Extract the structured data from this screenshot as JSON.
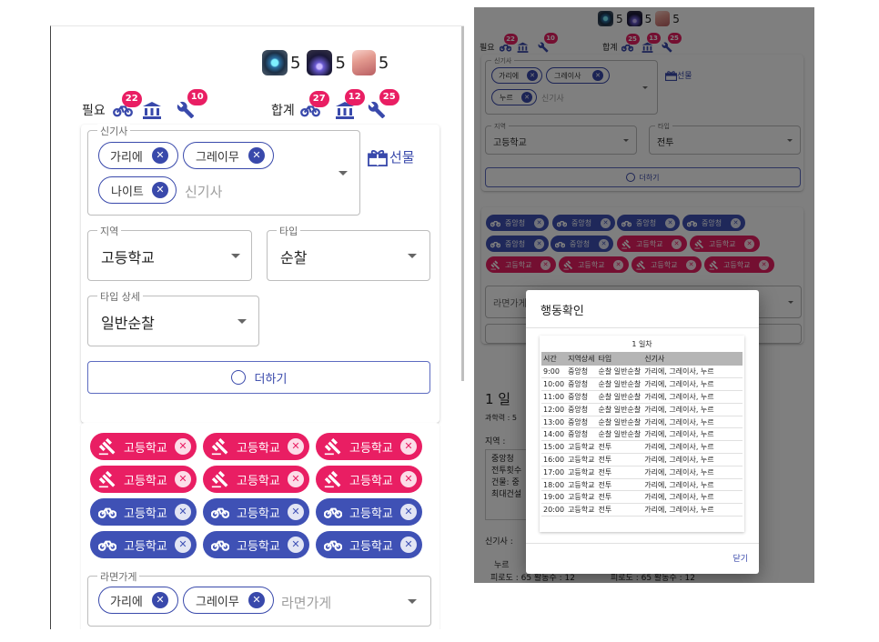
{
  "resources": [
    {
      "icon": "gear-crystal-icon",
      "value": "5"
    },
    {
      "icon": "dark-tower-icon",
      "value": "5"
    },
    {
      "icon": "scroll-book-icon",
      "value": "5"
    }
  ],
  "need": {
    "label": "필요",
    "badges": {
      "bike": "22",
      "bank": "",
      "wrench": "10"
    }
  },
  "total": {
    "label": "합계",
    "badges": {
      "bike": "27",
      "bank": "12",
      "wrench": "25"
    }
  },
  "form": {
    "shingisa_label": "신기사",
    "shingisa_chips": [
      "가리에",
      "그레이무",
      "나이트"
    ],
    "shingisa_placeholder": "신기사",
    "gift_label": "선물",
    "region_label": "지역",
    "region_value": "고등학교",
    "type_label": "타입",
    "type_value": "순찰",
    "type_detail_label": "타입 상세",
    "type_detail_value": "일반순찰",
    "add_label": "더하기"
  },
  "tags": {
    "red": [
      "고등학교",
      "고등학교",
      "고등학교",
      "고등학교",
      "고등학교",
      "고등학교"
    ],
    "blue": [
      "고등학교",
      "고등학교",
      "고등학교",
      "고등학교",
      "고등학교",
      "고등학교"
    ]
  },
  "shop": {
    "label": "라면가게",
    "chips": [
      "가리에",
      "그레이무"
    ],
    "placeholder": "라면가게"
  },
  "right": {
    "resources": [
      "5",
      "5",
      "5"
    ],
    "need_label": "필요",
    "need_badges": {
      "bike": "22",
      "wrench": "10"
    },
    "total_label": "합계",
    "total_badges": {
      "bike": "25",
      "bank": "13",
      "wrench": "25"
    },
    "shingisa_label": "신기사",
    "chips": [
      "가리에",
      "그레이사",
      "누르"
    ],
    "shingisa_placeholder": "신기사",
    "gift_label": "선물",
    "region_label": "지역",
    "region_value": "고등학교",
    "type_label": "타입",
    "type_value": "전투",
    "add_label": "더하기",
    "blue_tags": [
      "중앙청",
      "중앙청",
      "중앙청",
      "중앙청",
      "중앙청",
      "중앙청"
    ],
    "red_tags": [
      "고등학교",
      "고등학교",
      "고등학교",
      "고등학교",
      "고등학교",
      "고등학교",
      "고등학교",
      "고등학교"
    ],
    "shop_label": "라면가게",
    "day_title": "1 일",
    "science_label": "과학력 : 5",
    "region_text": "지역 :",
    "detail_lines": [
      "중앙청",
      "전투횟수",
      "건물: 중",
      "최대건설"
    ],
    "shingisa_text": "신기사 :",
    "bottom_name": "누르",
    "bottom_stats": [
      "피로도 : 65 활동수 : 12",
      "피로도 : 65 활동수 : 12"
    ]
  },
  "dialog": {
    "title": "행동확인",
    "day_label": "1 일차",
    "headers": [
      "시간",
      "지역상세",
      "타입",
      "신기사"
    ],
    "rows": [
      [
        "9:00",
        "중앙청",
        "순찰 일반순찰",
        "가리에, 그레이사, 누르"
      ],
      [
        "10:00",
        "중앙청",
        "순찰 일반순찰",
        "가리에, 그레이사, 누르"
      ],
      [
        "11:00",
        "중앙청",
        "순찰 일반순찰",
        "가리에, 그레이사, 누르"
      ],
      [
        "12:00",
        "중앙청",
        "순찰 일반순찰",
        "가리에, 그레이사, 누르"
      ],
      [
        "13:00",
        "중앙청",
        "순찰 일반순찰",
        "가리에, 그레이사, 누르"
      ],
      [
        "14:00",
        "중앙청",
        "순찰 일반순찰",
        "가리에, 그레이사, 누르"
      ],
      [
        "15:00",
        "고등학교",
        "전투",
        "가리에, 그레이사, 누르"
      ],
      [
        "16:00",
        "고등학교",
        "전투",
        "가리에, 그레이사, 누르"
      ],
      [
        "17:00",
        "고등학교",
        "전투",
        "가리에, 그레이사, 누르"
      ],
      [
        "18:00",
        "고등학교",
        "전투",
        "가리에, 그레이사, 누르"
      ],
      [
        "19:00",
        "고등학교",
        "전투",
        "가리에, 그레이사, 누르"
      ],
      [
        "20:00",
        "고등학교",
        "전투",
        "가리에, 그레이사, 누르"
      ]
    ],
    "close_label": "닫기"
  },
  "colors": {
    "primary": "#3f51b5",
    "accent": "#e91e63",
    "indigo_text": "#3949ab"
  }
}
